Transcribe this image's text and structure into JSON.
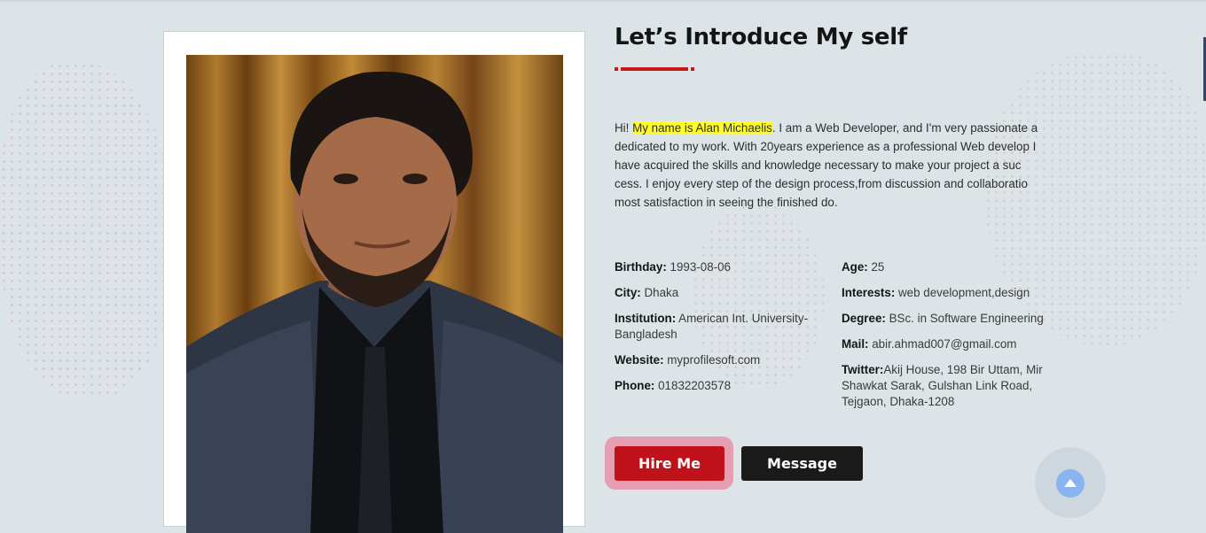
{
  "about": {
    "title": "Let’s Introduce My self",
    "intro": {
      "prefix": "Hi! ",
      "highlight": "My name is Alan Michaelis",
      "rest": ". I am a Web Developer, and I'm very passionate a dedicated to my work. With 20years experience as a professional Web develop I have acquired the skills and knowledge necessary to make your project a suc cess. I enjoy every step of the design process,from discussion and collaboratio most satisfaction in seeing the finished do."
    },
    "details_left": [
      {
        "label": "Birthday:",
        "value": " 1993-08-06"
      },
      {
        "label": "City:",
        "value": " Dhaka"
      },
      {
        "label": "Institution:",
        "value": " American Int. University-Bangladesh"
      },
      {
        "label": "Website:",
        "value": " myprofilesoft.com"
      },
      {
        "label": "Phone:",
        "value": " 01832203578"
      }
    ],
    "details_right": [
      {
        "label": "Age:",
        "value": " 25"
      },
      {
        "label": "Interests:",
        "value": " web development,design"
      },
      {
        "label": "Degree:",
        "value": " BSc. in Software Engineering"
      },
      {
        "label": "Mail:",
        "value": " abir.ahmad007@gmail.com"
      },
      {
        "label": "Twitter:",
        "value": "Akij House, 198 Bir Uttam, Mir Shawkat Sarak, Gulshan Link Road, Tejgaon, Dhaka-1208"
      }
    ],
    "buttons": {
      "hire": "Hire Me",
      "message": "Message"
    }
  },
  "icons": {
    "scroll_top": "arrow-up-icon"
  },
  "colors": {
    "accent": "#c0121b",
    "dark_button": "#1a1a1a",
    "highlight": "#ffff26",
    "background": "#dde4e8"
  }
}
